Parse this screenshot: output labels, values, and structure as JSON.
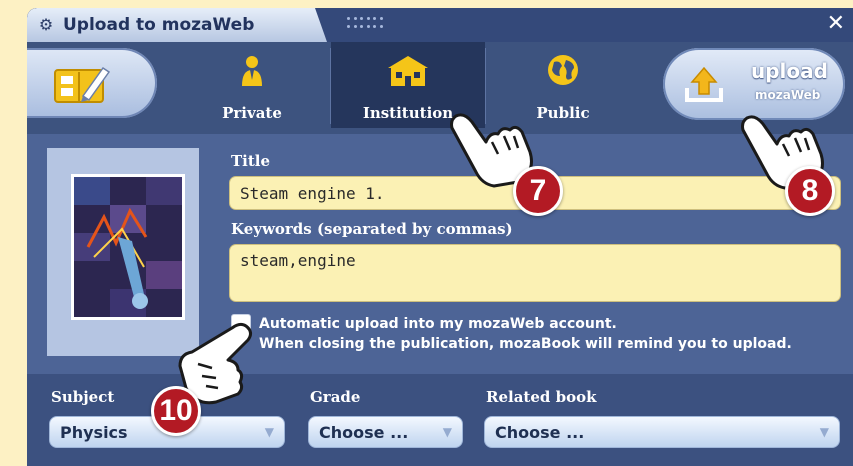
{
  "window": {
    "title": "Upload to mozaWeb",
    "close_glyph": "✕"
  },
  "toolbar": {
    "tabs": [
      {
        "label": "Private",
        "icon": "person-icon",
        "active": false
      },
      {
        "label": "Institution",
        "icon": "building-icon",
        "active": true
      },
      {
        "label": "Public",
        "icon": "globe-icon",
        "active": false
      }
    ],
    "upload": {
      "label": "upload",
      "sublabel": "mozaWeb",
      "icon": "upload-icon"
    }
  },
  "form": {
    "title_label": "Title",
    "title_value": "Steam engine 1.",
    "keywords_label": "Keywords (separated by commas)",
    "keywords_value": "steam,engine",
    "auto_upload_line1": "Automatic upload into my mozaWeb account.",
    "auto_upload_line2": "When closing the publication, mozaBook will remind you to upload.",
    "auto_upload_checked": false
  },
  "selectors": {
    "subject_label": "Subject",
    "subject_value": "Physics",
    "grade_label": "Grade",
    "grade_value": "Choose ...",
    "related_label": "Related book",
    "related_value": "Choose ..."
  },
  "callouts": [
    "7",
    "8",
    "10"
  ],
  "colors": {
    "panel": "#4d6496",
    "input_bg": "#fbf1b4",
    "badge": "#b31a24",
    "page_bg": "#fdf1c4"
  }
}
